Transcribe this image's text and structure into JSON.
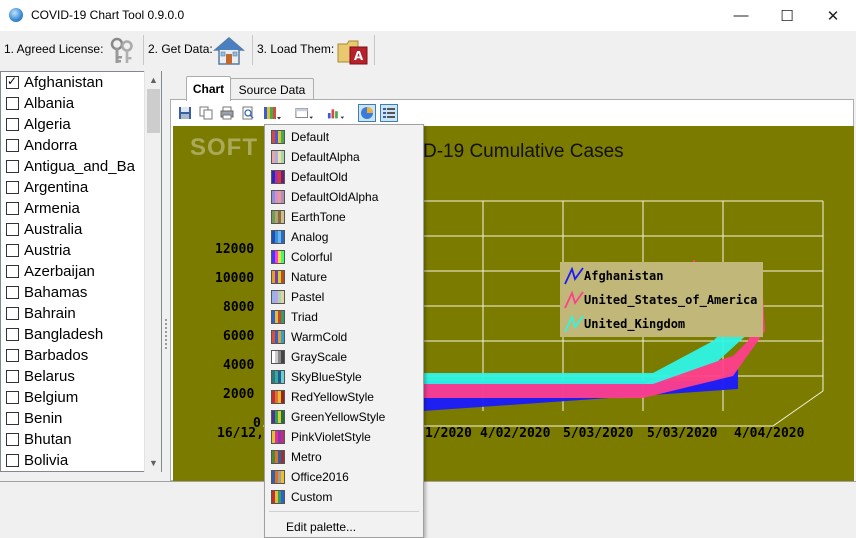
{
  "window": {
    "title": "COVID-19 Chart Tool 0.9.0.0",
    "minimize": "—",
    "maximize": "☐",
    "close": "✕"
  },
  "toolbar": {
    "step1": "1. Agreed License:",
    "step2": "2. Get Data:",
    "step3": "3. Load Them:"
  },
  "countries": [
    {
      "label": "Afghanistan",
      "checked": true
    },
    {
      "label": "Albania",
      "checked": false
    },
    {
      "label": "Algeria",
      "checked": false
    },
    {
      "label": "Andorra",
      "checked": false
    },
    {
      "label": "Antigua_and_Ba",
      "checked": false
    },
    {
      "label": "Argentina",
      "checked": false
    },
    {
      "label": "Armenia",
      "checked": false
    },
    {
      "label": "Australia",
      "checked": false
    },
    {
      "label": "Austria",
      "checked": false
    },
    {
      "label": "Azerbaijan",
      "checked": false
    },
    {
      "label": "Bahamas",
      "checked": false
    },
    {
      "label": "Bahrain",
      "checked": false
    },
    {
      "label": "Bangladesh",
      "checked": false
    },
    {
      "label": "Barbados",
      "checked": false
    },
    {
      "label": "Belarus",
      "checked": false
    },
    {
      "label": "Belgium",
      "checked": false
    },
    {
      "label": "Benin",
      "checked": false
    },
    {
      "label": "Bhutan",
      "checked": false
    },
    {
      "label": "Bolivia",
      "checked": false
    }
  ],
  "tabs": {
    "chart": "Chart",
    "source": "Source Data"
  },
  "chart": {
    "title": "D-19 Cumulative Cases",
    "watermark": "SOFT",
    "yticks": [
      "12000",
      "10000",
      "8000",
      "6000",
      "4000",
      "2000",
      "0"
    ],
    "xticks": [
      "16/12,",
      "1/2020",
      "4/02/2020",
      "5/03/2020",
      "5/03/2020",
      "4/04/2020"
    ],
    "legend": [
      {
        "name": "Afghanistan",
        "color": "#1a1aff"
      },
      {
        "name": "United_States_of_America",
        "color": "#ff3f8c"
      },
      {
        "name": "United_Kingdom",
        "color": "#2ef5e6"
      }
    ],
    "colors": {
      "background": "#7b7b00",
      "grid": "#ffffff"
    }
  },
  "palette_menu": {
    "items": [
      {
        "label": "Default",
        "colors": [
          "#d94a3d",
          "#4a5bd9",
          "#e0c23a",
          "#3fb04f"
        ]
      },
      {
        "label": "DefaultAlpha",
        "colors": [
          "#e8a7a0",
          "#a8aee6",
          "#efe0a0",
          "#a5d8ad"
        ]
      },
      {
        "label": "DefaultOld",
        "colors": [
          "#2a2ab8",
          "#b82aa0",
          "#d43a3a",
          "#6a1f7a"
        ]
      },
      {
        "label": "DefaultOldAlpha",
        "colors": [
          "#8f8fd8",
          "#d68fca",
          "#e89a9a",
          "#b08fbc"
        ]
      },
      {
        "label": "EarthTone",
        "colors": [
          "#6f9c5b",
          "#b6a26a",
          "#8a6a45",
          "#cdbf88"
        ]
      },
      {
        "label": "Analog",
        "colors": [
          "#1e4fb8",
          "#3a8fd6",
          "#6ab7ea",
          "#2a6ac4"
        ]
      },
      {
        "label": "Colorful",
        "colors": [
          "#3b3bff",
          "#ff3bd1",
          "#ffd83b",
          "#3bff6a"
        ]
      },
      {
        "label": "Nature",
        "colors": [
          "#e0a020",
          "#7a3ab0",
          "#d0d030",
          "#c04a20"
        ]
      },
      {
        "label": "Pastel",
        "colors": [
          "#8fb8e8",
          "#c8a0e0",
          "#a0d8b8",
          "#e8d0a0"
        ]
      },
      {
        "label": "Triad",
        "colors": [
          "#3060d0",
          "#e0c030",
          "#d04030",
          "#30a060"
        ]
      },
      {
        "label": "WarmCold",
        "colors": [
          "#e05030",
          "#3060d0",
          "#e0a030",
          "#30a0d0"
        ]
      },
      {
        "label": "GrayScale",
        "colors": [
          "#ffffff",
          "#cccccc",
          "#888888",
          "#444444"
        ]
      },
      {
        "label": "SkyBlueStyle",
        "colors": [
          "#2a7a7a",
          "#3aa6a6",
          "#1f5c8a",
          "#6ad0d0"
        ]
      },
      {
        "label": "RedYellowStyle",
        "colors": [
          "#c03030",
          "#e07030",
          "#e0c030",
          "#a02020"
        ]
      },
      {
        "label": "GreenYellowStyle",
        "colors": [
          "#503090",
          "#30a050",
          "#d0d030",
          "#207040"
        ]
      },
      {
        "label": "PinkVioletStyle",
        "colors": [
          "#e0c030",
          "#e03090",
          "#9030c0",
          "#c03070"
        ]
      },
      {
        "label": "Metro",
        "colors": [
          "#4a8a30",
          "#e07030",
          "#3060a0",
          "#a03030"
        ]
      },
      {
        "label": "Office2016",
        "colors": [
          "#3060b0",
          "#e07020",
          "#a0a0a0",
          "#f0c020"
        ]
      },
      {
        "label": "Custom",
        "colors": [
          "#c03030",
          "#e0c030",
          "#30a060",
          "#3060d0"
        ]
      }
    ],
    "edit_label": "Edit palette..."
  }
}
